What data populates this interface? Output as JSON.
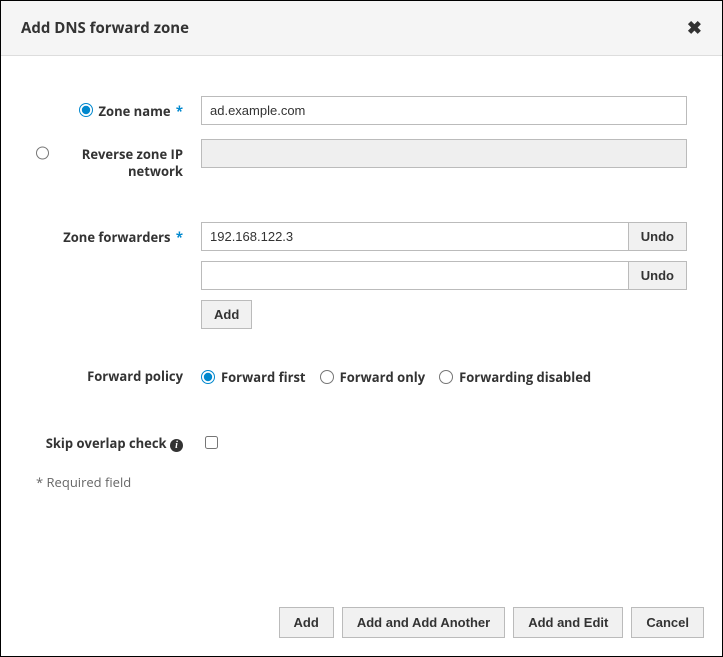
{
  "dialog": {
    "title": "Add DNS forward zone"
  },
  "labels": {
    "zone_name": "Zone name",
    "reverse_zone": "Reverse zone IP network",
    "zone_forwarders": "Zone forwarders",
    "forward_policy": "Forward policy",
    "skip_overlap": "Skip overlap check"
  },
  "fields": {
    "zone_name_value": "ad.example.com",
    "reverse_zone_value": "",
    "forwarders": [
      "192.168.122.3",
      ""
    ]
  },
  "buttons": {
    "undo": "Undo",
    "add_small": "Add",
    "add": "Add",
    "add_and_another": "Add and Add Another",
    "add_and_edit": "Add and Edit",
    "cancel": "Cancel"
  },
  "policy": {
    "first": "Forward first",
    "only": "Forward only",
    "disabled": "Forwarding disabled"
  },
  "required_note": "* Required field"
}
